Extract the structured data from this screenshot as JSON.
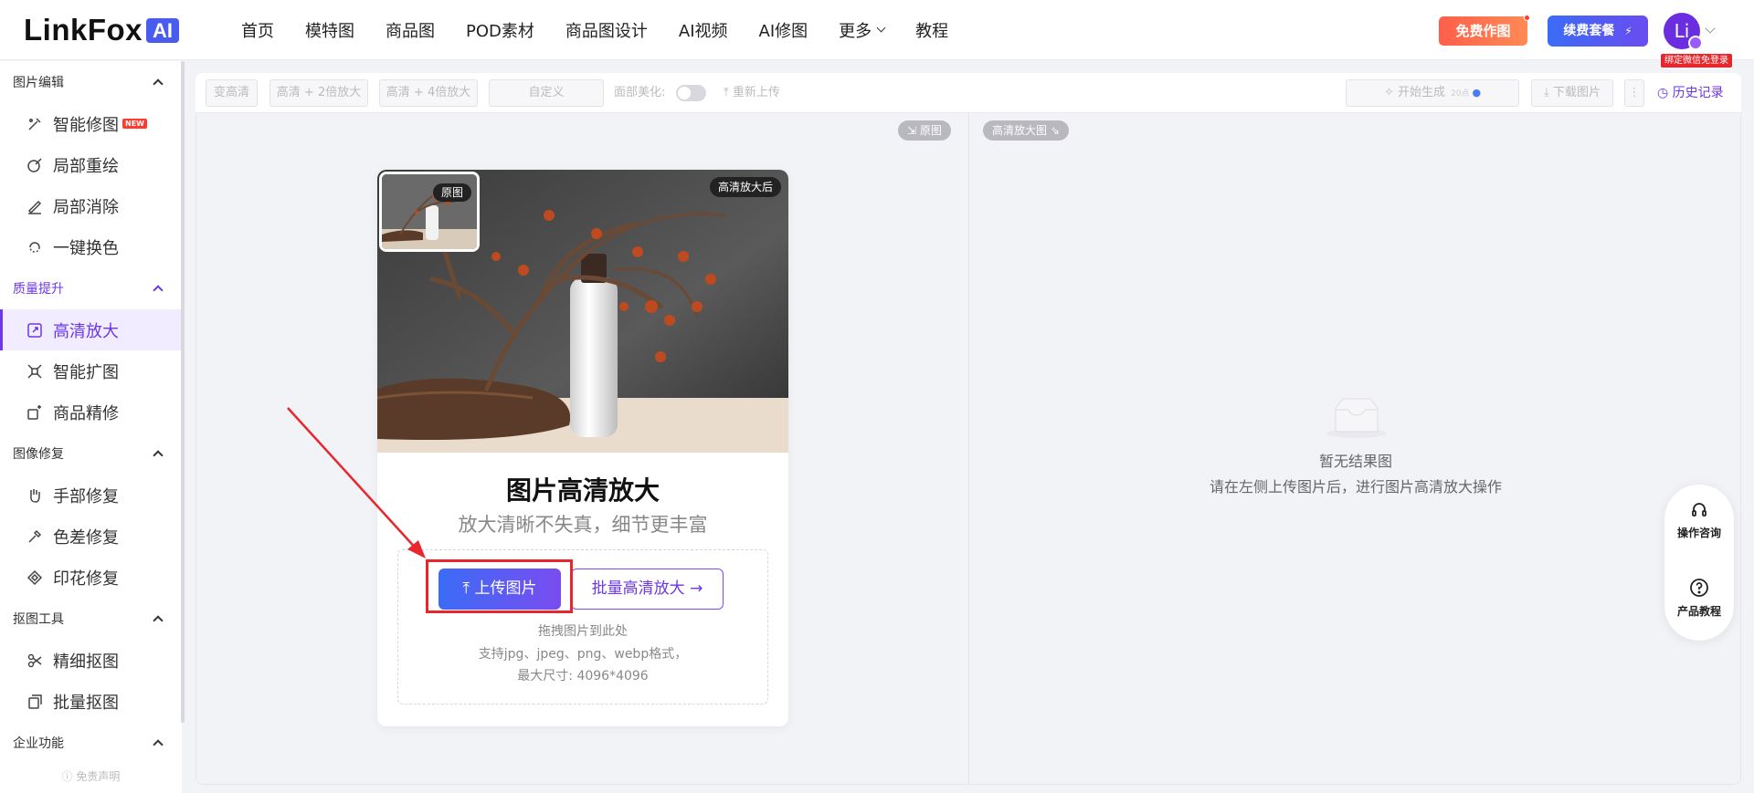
{
  "brand": {
    "name": "LinkFox",
    "suffix": "AI"
  },
  "nav": [
    "首页",
    "模特图",
    "商品图",
    "POD素材",
    "商品图设计",
    "AI视频",
    "AI修图",
    "更多",
    "教程"
  ],
  "header": {
    "free_label": "免费作图",
    "renew_label": "续费套餐",
    "renew_icon": "⚡",
    "avatar_initial": "Li",
    "wechat_tag": "绑定微信免登录"
  },
  "sidebar": {
    "groups": [
      {
        "label": "图片编辑",
        "items": [
          "智能修图",
          "局部重绘",
          "局部消除",
          "一键换色"
        ]
      },
      {
        "label": "质量提升",
        "items": [
          "高清放大",
          "智能扩图",
          "商品精修"
        ]
      },
      {
        "label": "图像修复",
        "items": [
          "手部修复",
          "色差修复",
          "印花修复"
        ]
      },
      {
        "label": "抠图工具",
        "items": [
          "精细抠图",
          "批量抠图"
        ]
      },
      {
        "label": "企业功能",
        "items": []
      }
    ],
    "new_badge": "NEW",
    "disclaimer": "免责声明"
  },
  "toolbar": {
    "b1": "变高清",
    "b2": "高清 + 2倍放大",
    "b3": "高清 + 4倍放大",
    "b4": "自定义",
    "face_label": "面部美化:",
    "reupload": "重新上传",
    "generate": "开始生成",
    "cost": "20点",
    "download": "下载图片",
    "more": "⋮",
    "history": "历史记录"
  },
  "left": {
    "orig_pill": "原图",
    "card_title": "图片高清放大",
    "card_subtitle": "放大清晰不失真，细节更丰富",
    "tag_orig": "原图",
    "tag_after": "高清放大后",
    "upload_label": "上传图片",
    "batch_label": "批量高清放大",
    "hint1": "拖拽图片到此处",
    "hint2": "支持jpg、jpeg、png、webp格式，",
    "hint3": "最大尺寸: 4096*4096"
  },
  "right": {
    "result_pill": "高清放大图",
    "empty_title": "暂无结果图",
    "empty_desc": "请在左侧上传图片后，进行图片高清放大操作"
  },
  "float": {
    "consult": "操作咨询",
    "tutorial": "产品教程"
  },
  "colors": {
    "accent": "#6c37e8",
    "annotation_red": "#e8262d"
  }
}
